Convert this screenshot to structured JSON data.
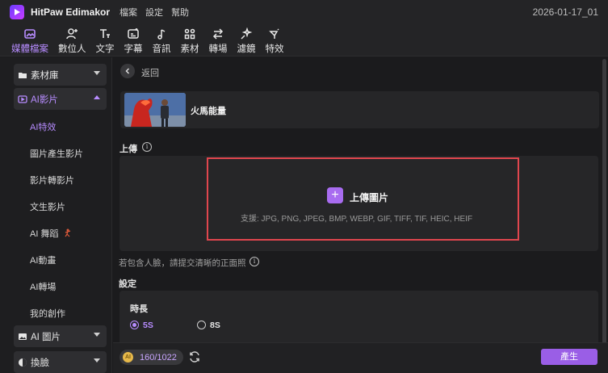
{
  "titlebar": {
    "app_name": "HitPaw Edimakor",
    "menus": [
      "檔案",
      "設定",
      "幫助"
    ],
    "project_name": "2026-01-17_01"
  },
  "toolbar": {
    "items": [
      {
        "label": "媒體檔案",
        "icon": "media-icon",
        "active": true
      },
      {
        "label": "數位人",
        "icon": "avatar-plus-icon",
        "active": false
      },
      {
        "label": "文字",
        "icon": "text-icon",
        "active": false
      },
      {
        "label": "字幕",
        "icon": "subtitle-icon",
        "active": false
      },
      {
        "label": "音訊",
        "icon": "music-icon",
        "active": false
      },
      {
        "label": "素材",
        "icon": "assets-icon",
        "active": false
      },
      {
        "label": "轉場",
        "icon": "transition-icon",
        "active": false
      },
      {
        "label": "濾鏡",
        "icon": "filter-icon",
        "active": false
      },
      {
        "label": "特效",
        "icon": "effects-icon",
        "active": false
      }
    ]
  },
  "sidebar": {
    "material_library": "素材庫",
    "ai_video": "AI影片",
    "ai_video_items": [
      "AI特效",
      "圖片產生影片",
      "影片轉影片",
      "文生影片",
      "AI 舞蹈",
      "AI動畫",
      "AI轉場",
      "我的創作"
    ],
    "ai_image": "AI 圖片",
    "face_swap": "換臉"
  },
  "main": {
    "back_label": "返回",
    "effect_title": "火馬能量",
    "upload_section_label": "上傳",
    "upload_button_label": "上傳圖片",
    "upload_formats_hint": "支援: JPG, PNG, JPEG, BMP, WEBP, GIF, TIFF, TIF, HEIC, HEIF",
    "face_hint": "若包含人臉，請提交清晰的正面照",
    "settings_label": "設定",
    "duration_label": "時長",
    "duration_options": [
      "5S",
      "8S"
    ],
    "duration_selected": "5S"
  },
  "bottombar": {
    "credits": "160/1022",
    "generate_label": "產生"
  },
  "colors": {
    "accent": "#b78cff",
    "generate_button": "#9a5ee6",
    "highlight_border": "#e0464e"
  }
}
